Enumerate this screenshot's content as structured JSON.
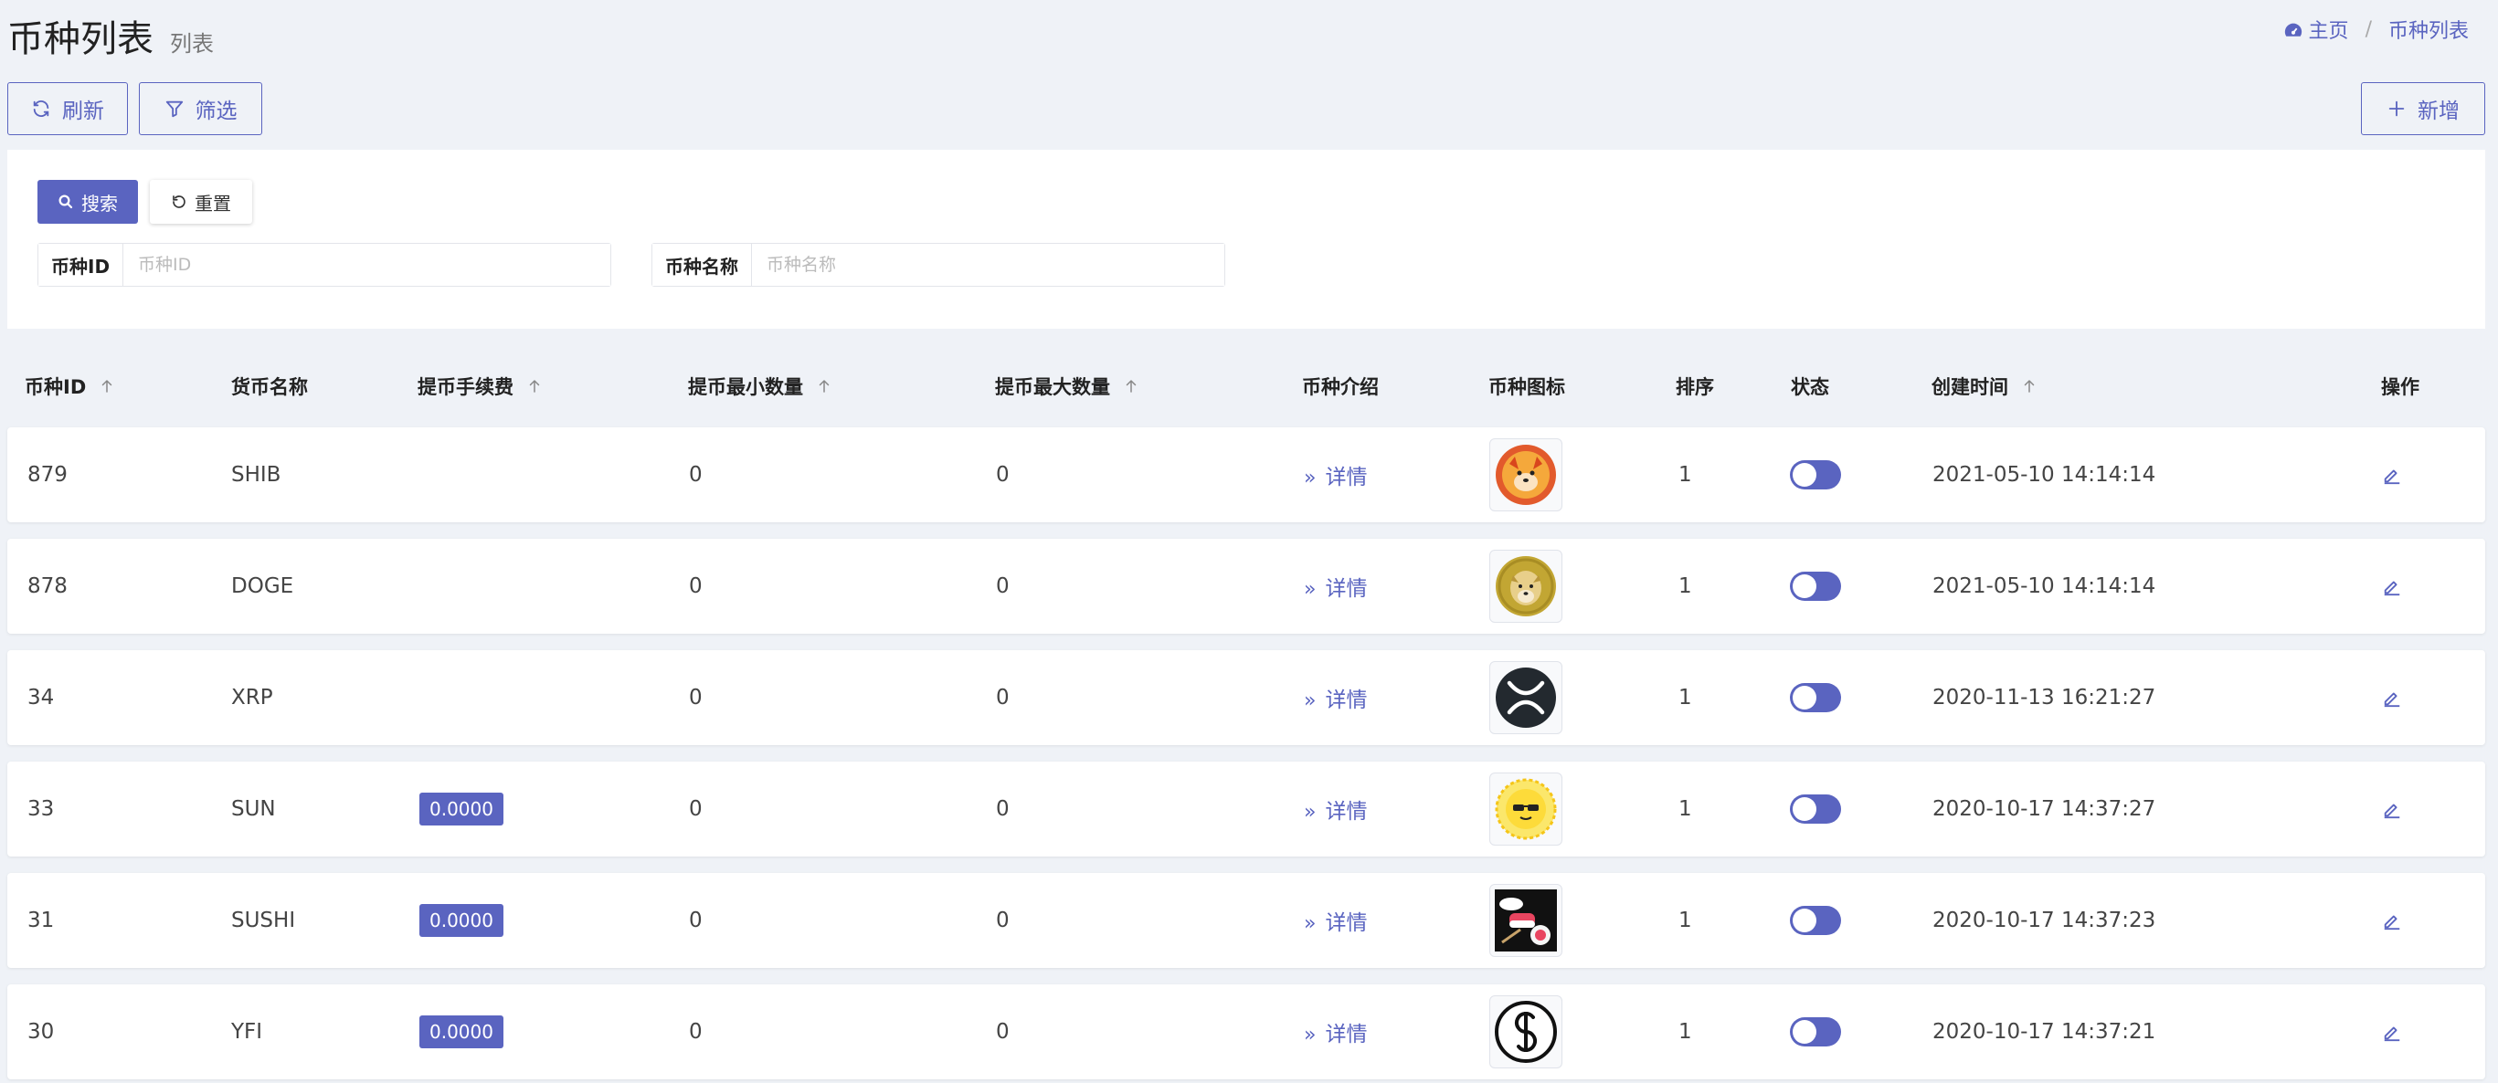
{
  "header": {
    "title": "币种列表",
    "subtitle": "列表",
    "breadcrumb": {
      "home": "主页",
      "separator": "/",
      "current": "币种列表"
    }
  },
  "toolbar": {
    "refresh": "刷新",
    "filter": "筛选",
    "add": "新增"
  },
  "search": {
    "search_button": "搜索",
    "reset_button": "重置",
    "fields": [
      {
        "label": "币种ID",
        "placeholder": "币种ID",
        "value": ""
      },
      {
        "label": "币种名称",
        "placeholder": "币种名称",
        "value": ""
      }
    ]
  },
  "table": {
    "columns": {
      "id": "币种ID",
      "name": "货币名称",
      "fee": "提币手续费",
      "min": "提币最小数量",
      "max": "提币最大数量",
      "intro": "币种介绍",
      "icon": "币种图标",
      "sort": "排序",
      "status": "状态",
      "created": "创建时间",
      "ops": "操作"
    },
    "detail_label": "详情",
    "rows": [
      {
        "id": "879",
        "name": "SHIB",
        "fee": "",
        "min": "0",
        "max": "0",
        "icon": "shib-coin-icon",
        "sort": "1",
        "status": "on",
        "created": "2021-05-10 14:14:14"
      },
      {
        "id": "878",
        "name": "DOGE",
        "fee": "",
        "min": "0",
        "max": "0",
        "icon": "doge-coin-icon",
        "sort": "1",
        "status": "on",
        "created": "2021-05-10 14:14:14"
      },
      {
        "id": "34",
        "name": "XRP",
        "fee": "",
        "min": "0",
        "max": "0",
        "icon": "xrp-coin-icon",
        "sort": "1",
        "status": "on",
        "created": "2020-11-13 16:21:27"
      },
      {
        "id": "33",
        "name": "SUN",
        "fee": "0.0000",
        "min": "0",
        "max": "0",
        "icon": "sun-coin-icon",
        "sort": "1",
        "status": "on",
        "created": "2020-10-17 14:37:27"
      },
      {
        "id": "31",
        "name": "SUSHI",
        "fee": "0.0000",
        "min": "0",
        "max": "0",
        "icon": "sushi-coin-icon",
        "sort": "1",
        "status": "on",
        "created": "2020-10-17 14:37:23"
      },
      {
        "id": "30",
        "name": "YFI",
        "fee": "0.0000",
        "min": "0",
        "max": "0",
        "icon": "yfi-coin-icon",
        "sort": "1",
        "status": "on",
        "created": "2020-10-17 14:37:21"
      }
    ]
  },
  "colors": {
    "accent": "#5a64c0",
    "background": "#eff2f7"
  }
}
